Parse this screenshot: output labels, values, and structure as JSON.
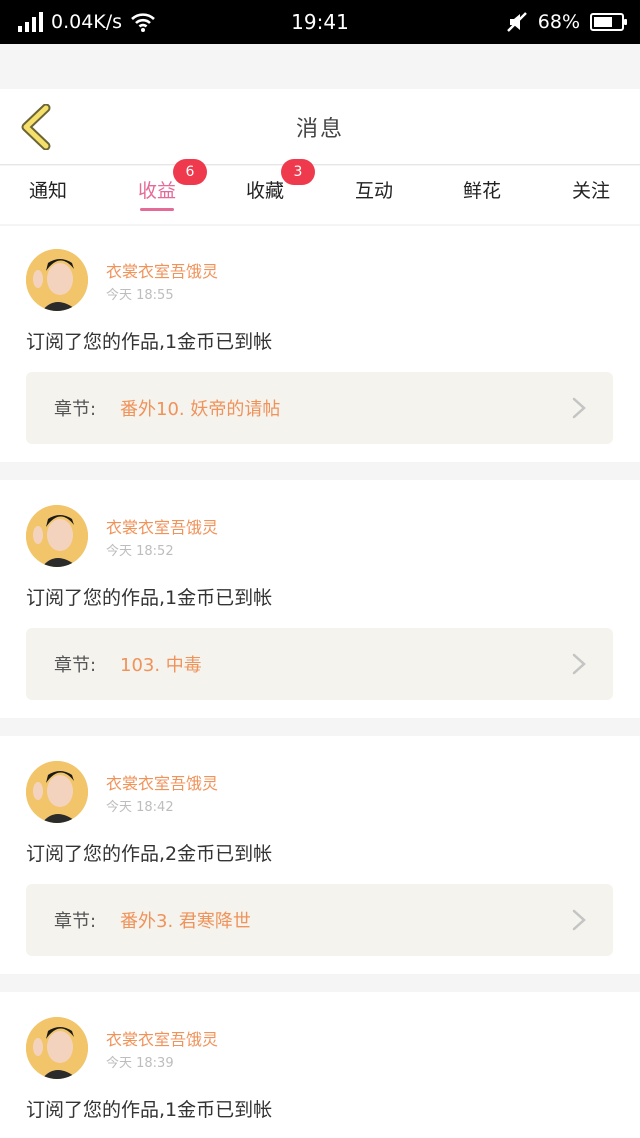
{
  "status_bar": {
    "network_speed": "0.04K/s",
    "time": "19:41",
    "battery": "68%",
    "battery_level": 0.68
  },
  "header": {
    "title": "消息"
  },
  "tabs": [
    {
      "label": "通知",
      "badge": ""
    },
    {
      "label": "收益",
      "badge": "6",
      "active": true
    },
    {
      "label": "收藏",
      "badge": "3"
    },
    {
      "label": "互动",
      "badge": ""
    },
    {
      "label": "鲜花",
      "badge": ""
    },
    {
      "label": "关注",
      "badge": ""
    }
  ],
  "messages": [
    {
      "author": "衣裳衣室吾饿灵",
      "time": "今天 18:55",
      "text": "订阅了您的作品,1金币已到帐",
      "chapter_label": "章节:",
      "chapter_title": "番外10. 妖帝的请帖"
    },
    {
      "author": "衣裳衣室吾饿灵",
      "time": "今天 18:52",
      "text": "订阅了您的作品,1金币已到帐",
      "chapter_label": "章节:",
      "chapter_title": "103. 中毒"
    },
    {
      "author": "衣裳衣室吾饿灵",
      "time": "今天 18:42",
      "text": "订阅了您的作品,2金币已到帐",
      "chapter_label": "章节:",
      "chapter_title": "番外3. 君寒降世"
    },
    {
      "author": "衣裳衣室吾饿灵",
      "time": "今天 18:39",
      "text": "订阅了您的作品,1金币已到帐"
    }
  ],
  "colors": {
    "accent": "#e46a97",
    "author": "#f0935a",
    "badge": "#ee3a4c",
    "chapter_bg": "#f4f3ee"
  }
}
